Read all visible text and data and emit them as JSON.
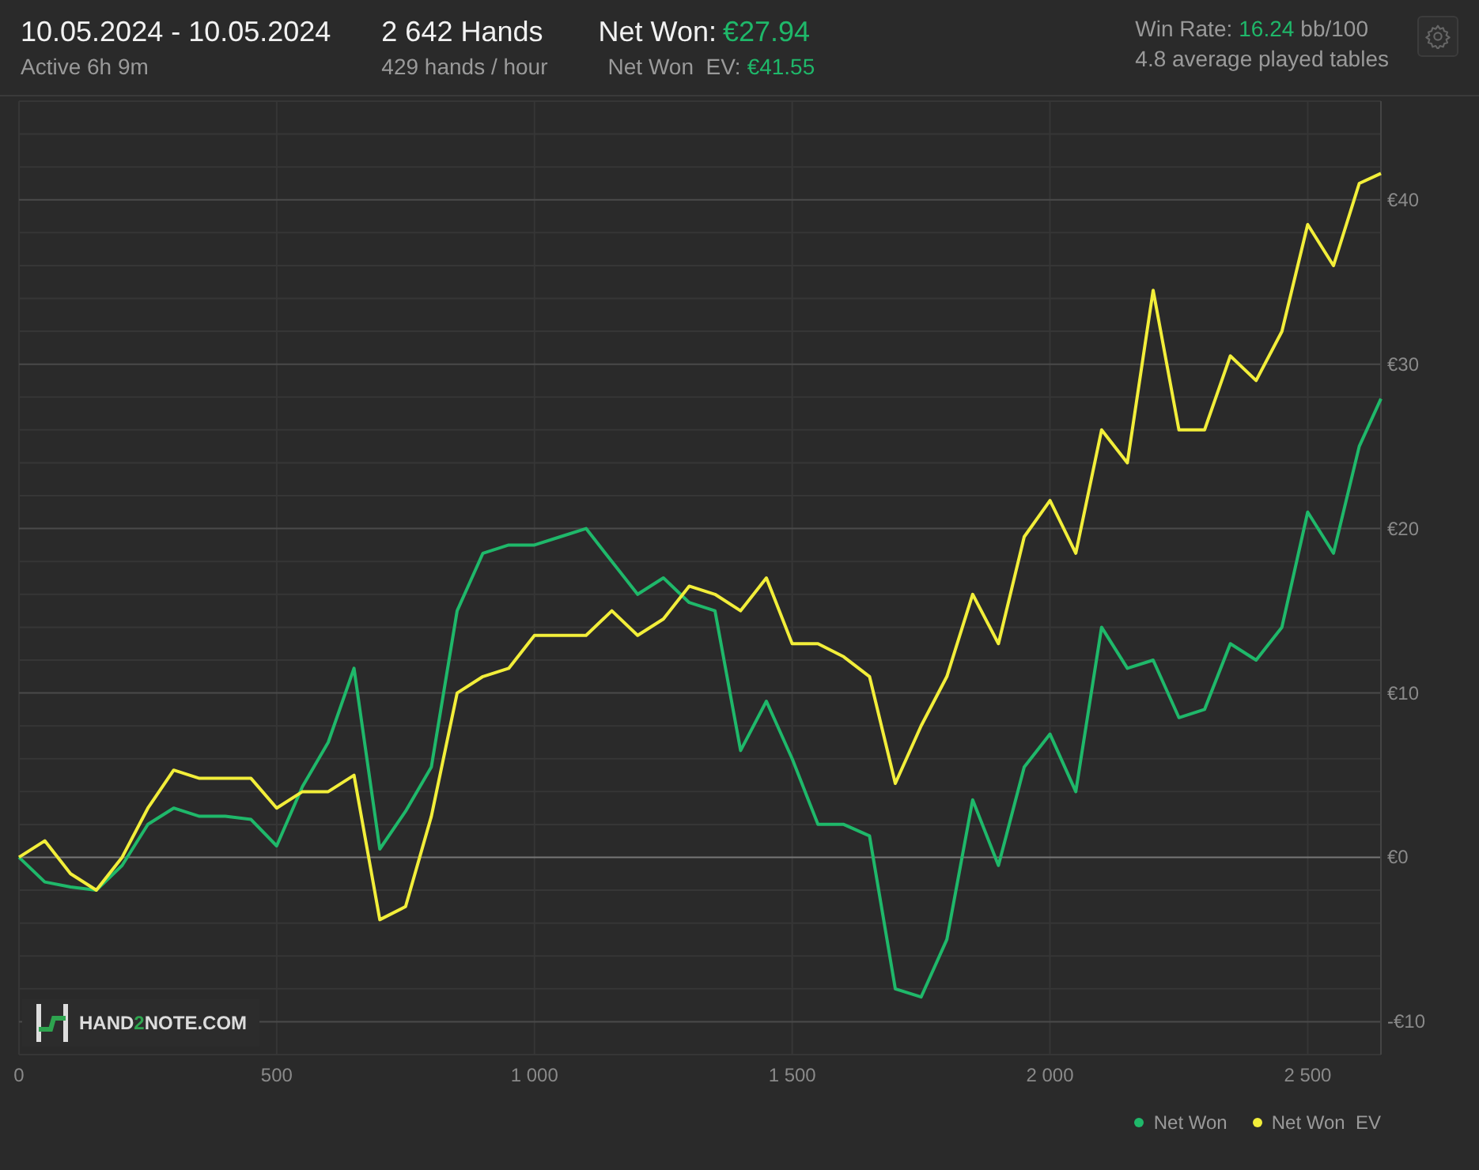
{
  "header": {
    "date_range": "10.05.2024 - 10.05.2024",
    "active": "Active 6h 9m",
    "hands": "2 642 Hands",
    "hands_rate": "429 hands / hour",
    "net_won": {
      "label": "Net Won:",
      "value": "€27.94"
    },
    "net_won_ev": {
      "label": "Net Won  EV:",
      "value": "€41.55"
    },
    "win_rate": {
      "label": "Win Rate:",
      "value": "16.24",
      "unit": "bb/100"
    },
    "tables": "4.8 average played tables"
  },
  "chart": {
    "logo": {
      "parts": [
        "HAND",
        "2",
        "NOTE.COM"
      ]
    },
    "chart_data": {
      "type": "line",
      "grid": true,
      "xlim": [
        0,
        2642
      ],
      "ylim": [
        -12,
        46
      ],
      "xticks": [
        {
          "value": 0,
          "label": "0"
        },
        {
          "value": 500,
          "label": "500"
        },
        {
          "value": 1000,
          "label": "1 000"
        },
        {
          "value": 1500,
          "label": "1 500"
        },
        {
          "value": 2000,
          "label": "2 000"
        },
        {
          "value": 2500,
          "label": "2 500"
        }
      ],
      "yticks": [
        {
          "value": -10,
          "label": "-€10"
        },
        {
          "value": 0,
          "label": "€0"
        },
        {
          "value": 10,
          "label": "€10"
        },
        {
          "value": 20,
          "label": "€20"
        },
        {
          "value": 30,
          "label": "€30"
        },
        {
          "value": 40,
          "label": "€40"
        }
      ],
      "x": [
        0,
        50,
        100,
        150,
        200,
        250,
        300,
        350,
        400,
        450,
        500,
        550,
        600,
        650,
        700,
        750,
        800,
        850,
        900,
        950,
        1000,
        1050,
        1100,
        1150,
        1200,
        1250,
        1300,
        1350,
        1400,
        1450,
        1500,
        1550,
        1600,
        1650,
        1700,
        1750,
        1800,
        1850,
        1900,
        1950,
        2000,
        2050,
        2100,
        2150,
        2200,
        2250,
        2300,
        2350,
        2400,
        2450,
        2500,
        2550,
        2600,
        2642
      ],
      "series": [
        {
          "name": "Net Won",
          "color": "#1fb86a",
          "values": [
            0,
            -1.5,
            -1.8,
            -2,
            -0.5,
            2,
            3,
            2.5,
            2.5,
            2.3,
            0.7,
            4.3,
            7,
            11.5,
            0.5,
            2.8,
            5.5,
            15,
            18.5,
            19,
            19,
            19.5,
            20,
            18,
            16,
            17,
            15.5,
            15,
            6.5,
            9.5,
            6,
            2,
            2,
            1.3,
            -8,
            -8.5,
            -5,
            3.5,
            -0.5,
            5.5,
            7.5,
            4,
            14,
            11.5,
            12,
            8.5,
            9,
            13,
            12,
            14,
            21,
            18.5,
            25,
            27.9
          ]
        },
        {
          "name": "Net Won  EV",
          "color": "#f2ee3a",
          "values": [
            0,
            1,
            -1,
            -2,
            0,
            3,
            5.3,
            4.8,
            4.8,
            4.8,
            3,
            4,
            4,
            5,
            -3.8,
            -3,
            2.5,
            10,
            11,
            11.5,
            13.5,
            13.5,
            13.5,
            15,
            13.5,
            14.5,
            16.5,
            16,
            15,
            17,
            13,
            13,
            12.2,
            11,
            4.5,
            8,
            11,
            16,
            13,
            19.5,
            21.7,
            18.5,
            26,
            24,
            34.5,
            26,
            26,
            30.5,
            29,
            32,
            38.5,
            36,
            41,
            41.6
          ]
        }
      ]
    }
  }
}
